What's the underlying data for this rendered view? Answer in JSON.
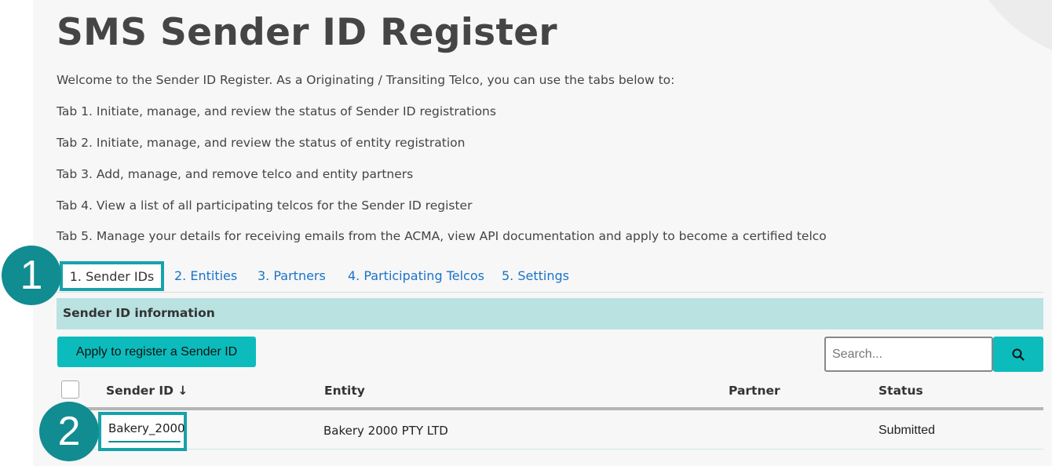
{
  "page": {
    "title": "SMS Sender ID Register",
    "intro": [
      "Welcome to the Sender ID Register. As a Originating / Transiting Telco, you can use the tabs below to:",
      "Tab 1. Initiate, manage, and review the status of Sender ID registrations",
      "Tab 2. Initiate, manage, and review the status of entity registration",
      "Tab 3. Add, manage, and remove telco and entity partners",
      "Tab 4. View a list of all participating telcos for the Sender ID register",
      "Tab 5. Manage your details for receiving emails from the ACMA, view API documentation and apply to become a certified telco"
    ]
  },
  "tabs": [
    {
      "label": "1. Sender IDs",
      "active": true
    },
    {
      "label": "2. Entities",
      "active": false
    },
    {
      "label": "3. Partners",
      "active": false
    },
    {
      "label": "4. Participating Telcos",
      "active": false
    },
    {
      "label": "5. Settings",
      "active": false
    }
  ],
  "callouts": [
    "1",
    "2"
  ],
  "section": {
    "title": "Sender ID information"
  },
  "actions": {
    "apply_label": "Apply to register a Sender ID",
    "search_placeholder": "Search...",
    "search_icon": "search-icon"
  },
  "table": {
    "columns": [
      "Sender ID ↓",
      "Entity",
      "Partner",
      "Status"
    ],
    "rows": [
      {
        "sender_id": "Bakery_2000",
        "entity": "Bakery 2000 PTY LTD",
        "partner": "",
        "status": "Submitted"
      }
    ]
  },
  "colors": {
    "accent": "#0cbcbd",
    "callout": "#118c91",
    "highlight": "#17a2aa",
    "section_bar": "#b9e2e1",
    "link": "#1a73c9"
  }
}
